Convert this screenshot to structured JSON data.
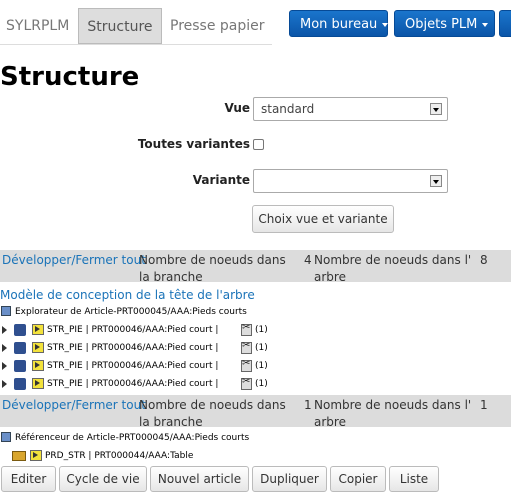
{
  "nav": {
    "brand": "SYLRPLM",
    "tabs": [
      "Structure",
      "Presse papier"
    ],
    "menus": [
      "Mon bureau",
      "Objets PLM"
    ]
  },
  "page": {
    "title": "Structure"
  },
  "form": {
    "vue_label": "Vue",
    "vue_value": "standard",
    "variantes_label": "Toutes variantes",
    "variante_label": "Variante",
    "variante_value": "",
    "submit_label": "Choix vue et variante"
  },
  "bars": [
    {
      "toggle": "Développer/Fermer tout",
      "branch_label": "Nombre de noeuds dans la branche",
      "branch_count": "4",
      "tree_label": "Nombre de noeuds dans l' arbre",
      "tree_count": "8"
    },
    {
      "toggle": "Développer/Fermer tout",
      "branch_label": "Nombre de noeuds dans la branche",
      "branch_count": "1",
      "tree_label": "Nombre de noeuds dans l' arbre",
      "tree_count": "1"
    }
  ],
  "tree": {
    "title": "Modèle de conception de la tête de l'arbre",
    "explorer": "Explorateur de Article-PRT000045/AAA:Pieds courts",
    "rows": [
      {
        "text": "STR_PIE | PRT000046/AAA:Pied court |",
        "count": "(1)"
      },
      {
        "text": "STR_PIE | PRT000046/AAA:Pied court |",
        "count": "(1)"
      },
      {
        "text": "STR_PIE | PRT000046/AAA:Pied court |",
        "count": "(1)"
      },
      {
        "text": "STR_PIE | PRT000046/AAA:Pied court |",
        "count": "(1)"
      }
    ],
    "referencer": "Référenceur de Article-PRT000045/AAA:Pieds courts",
    "prd_row": "PRD_STR | PRT000044/AAA:Table"
  },
  "actions": [
    "Editer",
    "Cycle de vie",
    "Nouvel article",
    "Dupliquer",
    "Copier",
    "Liste"
  ]
}
